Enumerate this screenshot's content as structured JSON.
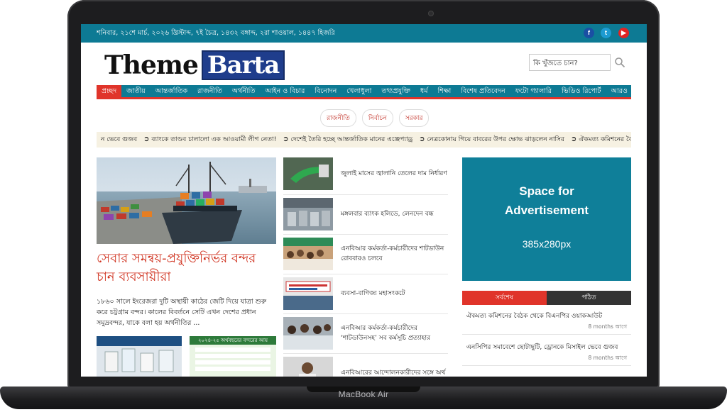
{
  "device": {
    "label": "MacBook Air"
  },
  "topbar": {
    "date": "শনিবার, ২১শে মার্চ, ২০২৬ খ্রিস্টাব্দ, ৭ই চৈত্র, ১৪৩২ বঙ্গাব্দ, ২রা শাওয়াল, ১৪৪৭ হিজরি",
    "social": [
      {
        "glyph": "f",
        "icon": "facebook-icon",
        "color": "#1a4fa3"
      },
      {
        "glyph": "t",
        "icon": "twitter-icon",
        "color": "#1d9bd1"
      },
      {
        "glyph": "▶",
        "icon": "youtube-icon",
        "color": "#e02424"
      }
    ]
  },
  "logo": {
    "part1": "Theme",
    "part2": "Barta"
  },
  "search": {
    "placeholder": "কি খুঁজতে চান?"
  },
  "nav": {
    "items": [
      "প্রচ্ছদ",
      "জাতীয়",
      "আন্তর্জাতিক",
      "রাজনীতি",
      "অর্থনীতি",
      "আইন ও বিচার",
      "বিনোদন",
      "খেলাধুলা",
      "তথ্যপ্রযুক্তি",
      "ধর্ম",
      "শিক্ষা",
      "বিশেষ প্রতিবেদন",
      "ফটো গ্যালারি",
      "ভিডিও রিপোর্ট",
      "আরও"
    ]
  },
  "tags": [
    "রাজনীতি",
    "নির্বাচন",
    "সরকার"
  ],
  "ticker": {
    "lead": "ন ভেবে গুজব",
    "items": [
      "ব্যাংকে তাণ্ডব চালালো এক আওয়ামী লীগ নেতা!",
      "দেশেই তৈরি হচ্ছে আন্তর্জাতিক মানের এঞ্জেপ্যাড্র",
      "নেত্রকোনায় গিয়ে বাবরের উপর ক্ষোভ ঝাড়লেন নাসির",
      "ঐকমত্য কমিশনের বৈঠক থেকে বিএনপির"
    ]
  },
  "lead": {
    "title": "সেবার সমন্বয়-প্রযুক্তিনির্ভর বন্দর চান ব্যবসায়ীরা",
    "summary": "১৮৬০ সালে ইংরেজরা দুটি অস্থায়ী কাঠের জেটি দিয়ে যাত্রা শুরু করে চট্টগ্রাম বন্দর। কালের বিবর্তনে সেটি এখন দেশের প্রধান সমুদ্রবন্দর, যাকে বলা হয় অর্থনীতির   ..."
  },
  "thumb_b_caption": "২০২৪-২৫ অর্থবছরের বন্দরের আয়",
  "news": [
    {
      "title": "জুলাই মাসের জ্বালানি তেলের দাম নির্ধারণ"
    },
    {
      "title": "মঙ্গলবার ব্যাংক হলিডে, লেনদেন বন্ধ"
    },
    {
      "title": "এনবিআর কর্মকর্তা-কর্মচারীদের শাটডাউন রোববারও চলবে"
    },
    {
      "title": "ব্যবসা-বাণিজ্য মহাসংকটে"
    },
    {
      "title": "এনবিআর কর্মকর্তা-কর্মচারীদের ‘শাটডাউনসহ’ সব কর্মসূচি প্রত্যাহার"
    },
    {
      "title": "এনবিআরের আন্দোলনকারীদের সঙ্গে অর্থ"
    }
  ],
  "ad": {
    "line1": "Space for",
    "line2": "Advertisement",
    "size": "385x280px"
  },
  "sidebar": {
    "tabs": [
      "সর্বশেষ",
      "পঠিত"
    ],
    "items": [
      {
        "title": "ঐকমত্য কমিশনের বৈঠক থেকে বিএনপির ওয়াকআউট",
        "time": "8 months আগে"
      },
      {
        "title": "এনসিপির সমাবেশে ছোটাছুটি, ড্রোনকে মিসাইল ভেবে গুজব",
        "time": "8 months আগে"
      }
    ]
  },
  "colors": {
    "brand_teal": "#0d7a94",
    "accent_red": "#e0342a",
    "logo_blue": "#1f3d8c"
  }
}
